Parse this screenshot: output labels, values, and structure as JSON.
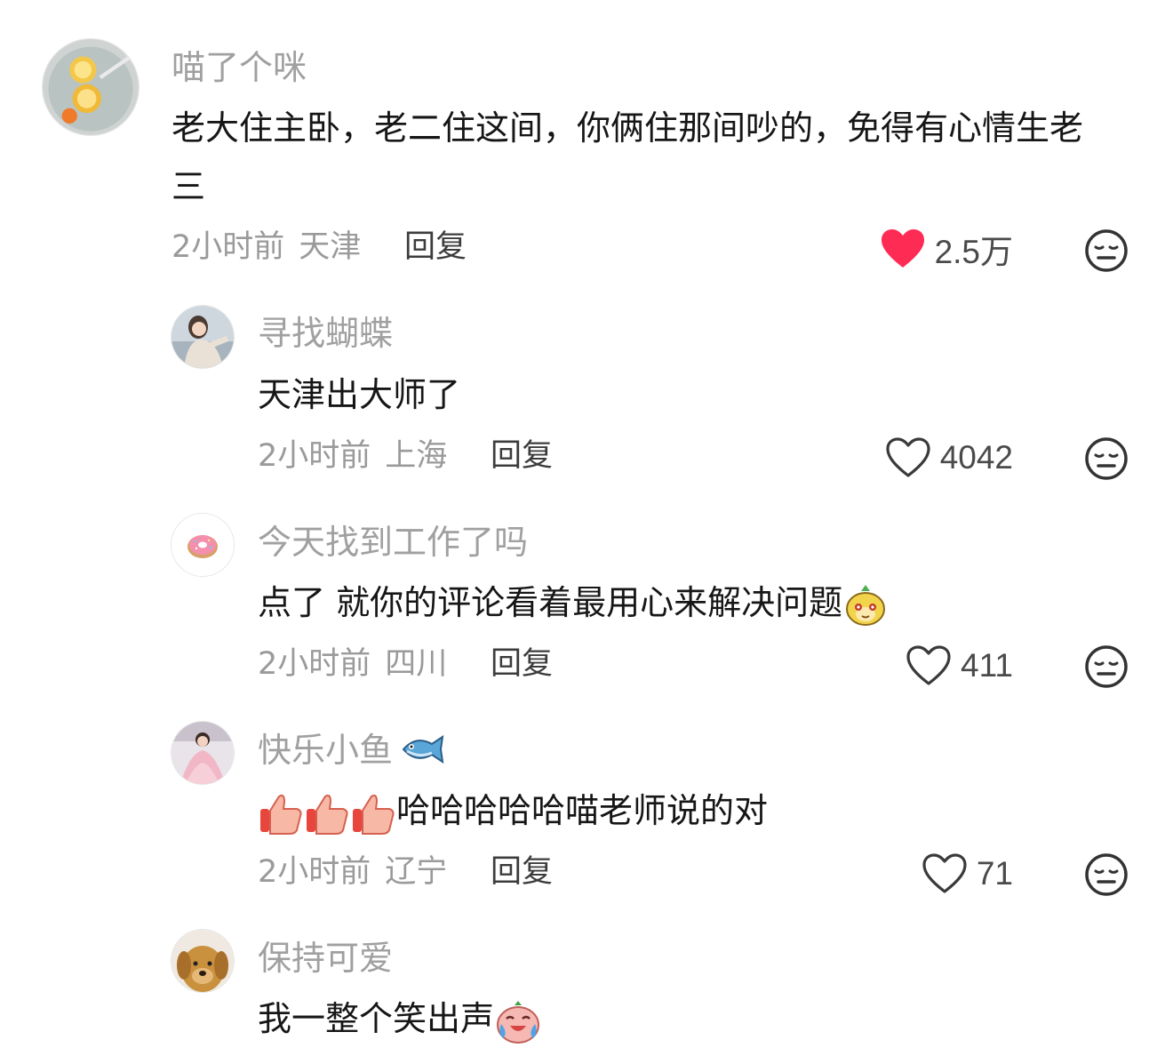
{
  "comments": [
    {
      "author": "喵了个咪",
      "text": "老大住主卧，老二住这间，你俩住那间吵的，免得有心情生老三",
      "time": "2小时前",
      "location": "天津",
      "reply_label": "回复",
      "likes": "2.5万",
      "liked": true,
      "avatar_icon": "lemon-drink-avatar"
    },
    {
      "author": "寻找蝴蝶",
      "text": "天津出大师了",
      "time": "2小时前",
      "location": "上海",
      "reply_label": "回复",
      "likes": "4042",
      "liked": false,
      "avatar_icon": "girl-photo-avatar"
    },
    {
      "author": "今天找到工作了吗",
      "text": "点了 就你的评论看着最用心来解决问题",
      "time": "2小时前",
      "location": "四川",
      "reply_label": "回复",
      "likes": "411",
      "liked": false,
      "avatar_icon": "donut-avatar",
      "trailing_emoji": "sly-fruit-emoji"
    },
    {
      "author": "快乐小鱼",
      "author_emoji": "fish-emoji",
      "text": "哈哈哈哈哈喵老师说的对",
      "leading_emojis": [
        "thumbs-up-emoji",
        "thumbs-up-emoji",
        "thumbs-up-emoji"
      ],
      "time": "2小时前",
      "location": "辽宁",
      "reply_label": "回复",
      "likes": "71",
      "liked": false,
      "avatar_icon": "child-dress-avatar"
    },
    {
      "author": "保持可爱",
      "text": "我一整个笑出声",
      "trailing_emoji": "crying-laugh-emoji",
      "avatar_icon": "dog-avatar"
    }
  ],
  "colors": {
    "like_active": "#fe2c55",
    "meta_text": "#9a9a9a",
    "author_text": "#a0a0a0",
    "body_text": "#161616"
  }
}
